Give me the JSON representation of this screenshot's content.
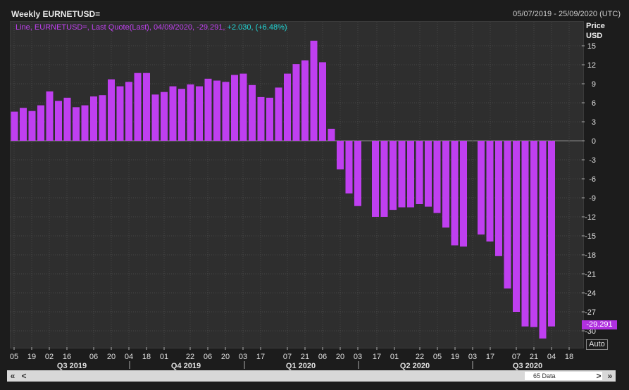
{
  "header": {
    "title": "Weekly EURNETUSD=",
    "date_range": "05/07/2019 - 25/09/2020 (UTC)"
  },
  "legend": {
    "prefix": "Line, EURNETUSD=, Last Quote(Last), 04/09/2020, -29.291,",
    "change": "+2.030, (+6.48%)"
  },
  "axis": {
    "y_title_1": "Price",
    "y_title_2": "USD",
    "last_value": "-29.291",
    "auto_label": "Auto"
  },
  "scrollbar": {
    "first_label": "«",
    "prev_label": "<",
    "next_label": ">",
    "last_label": "»",
    "data_count": "65 Data"
  },
  "colors": {
    "bar": "#bf3ff0",
    "grid": "#454545",
    "zero_line": "#8a8a8a"
  },
  "chart_data": {
    "type": "bar",
    "title": "Weekly EURNETUSD=",
    "ylabel": "Price USD",
    "ylim": [
      -31,
      16
    ],
    "y_ticks": [
      15,
      12,
      9,
      6,
      3,
      0,
      -3,
      -6,
      -9,
      -12,
      -15,
      -18,
      -21,
      -24,
      -27,
      -30
    ],
    "x_tick_labels": [
      "05",
      "19",
      "02",
      "16",
      "06",
      "20",
      "04",
      "18",
      "01",
      "22",
      "06",
      "20",
      "03",
      "17",
      "07",
      "21",
      "06",
      "20",
      "03",
      "17",
      "01",
      "22",
      "05",
      "19",
      "03",
      "17",
      "07",
      "21",
      "04",
      "18"
    ],
    "quarters": [
      "Q3 2019",
      "Q4 2019",
      "Q1 2020",
      "Q2 2020",
      "Q3 2020"
    ],
    "values": [
      4.6,
      5.2,
      4.7,
      5.6,
      7.8,
      6.3,
      6.8,
      5.3,
      5.6,
      7.0,
      7.2,
      9.7,
      8.6,
      9.3,
      10.7,
      10.7,
      7.3,
      7.7,
      8.6,
      8.2,
      8.9,
      8.6,
      9.8,
      9.5,
      9.3,
      10.4,
      10.6,
      8.8,
      6.9,
      6.8,
      8.4,
      10.6,
      12.1,
      12.7,
      15.8,
      12.4,
      1.9,
      -4.5,
      -8.3,
      -10.3,
      null,
      -12.0,
      -12.0,
      -10.9,
      -10.5,
      -10.5,
      -10.0,
      -10.4,
      -11.4,
      -13.7,
      -16.5,
      -16.7,
      null,
      -14.8,
      -15.9,
      -18.2,
      -23.3,
      -27.0,
      -29.3,
      -29.4,
      -31.2,
      -29.3,
      null,
      null,
      null
    ]
  }
}
